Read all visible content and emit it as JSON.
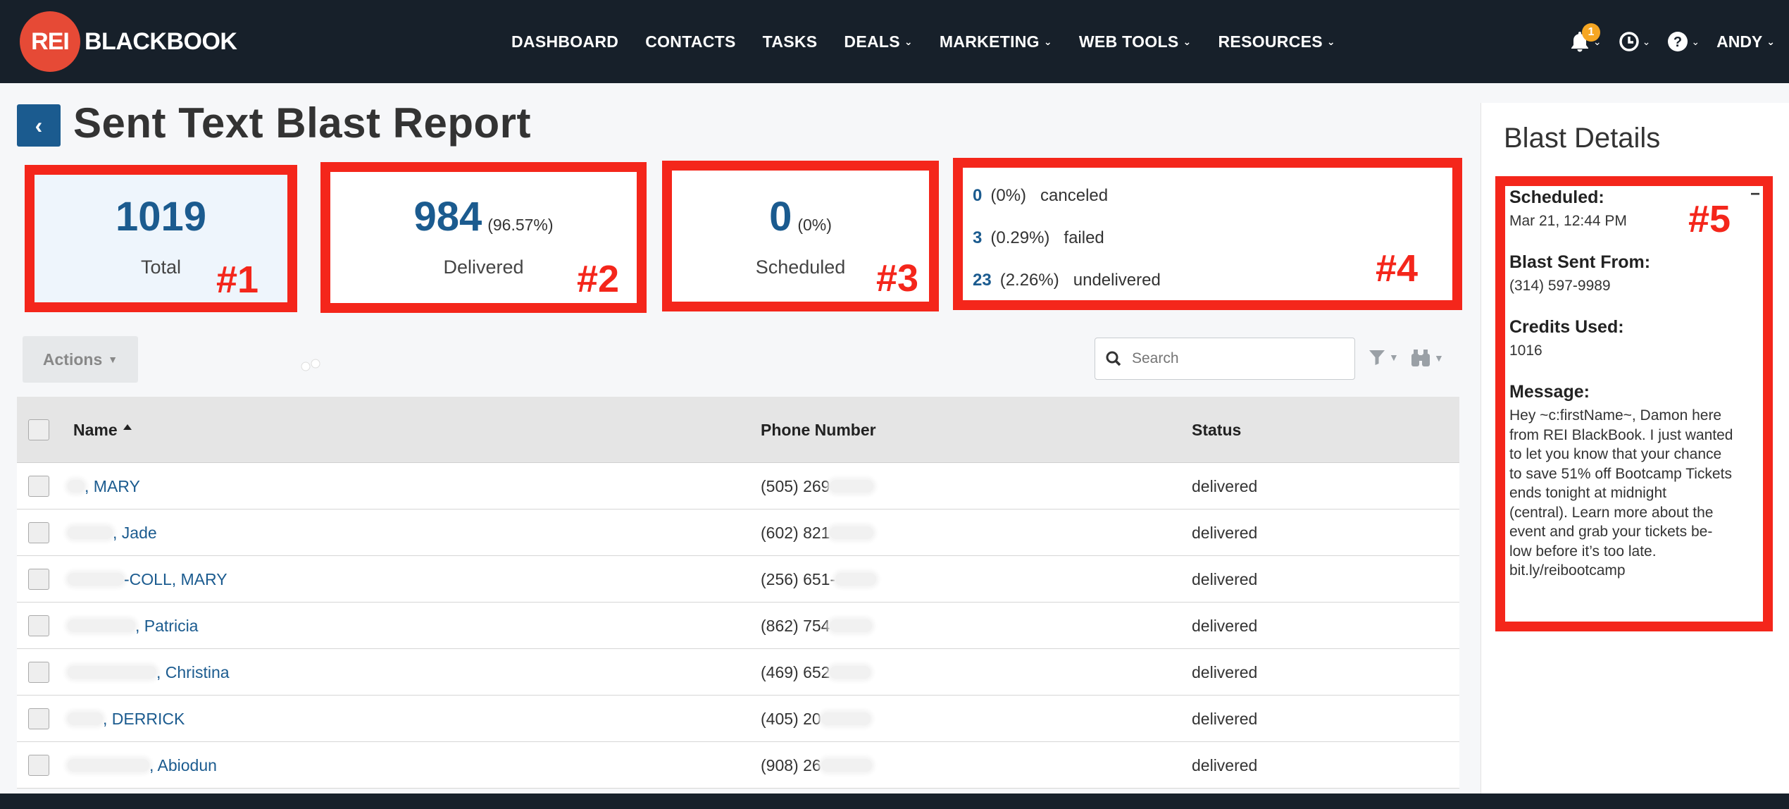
{
  "nav": {
    "logo_mark": "REI",
    "logo_text": "BLACKBOOK",
    "items": [
      {
        "label": "DASHBOARD",
        "dropdown": false
      },
      {
        "label": "CONTACTS",
        "dropdown": false
      },
      {
        "label": "TASKS",
        "dropdown": false
      },
      {
        "label": "DEALS",
        "dropdown": true
      },
      {
        "label": "MARKETING",
        "dropdown": true
      },
      {
        "label": "WEB TOOLS",
        "dropdown": true
      },
      {
        "label": "RESOURCES",
        "dropdown": true
      }
    ],
    "notification_count": "1",
    "user": "ANDY",
    "caret": "⌄"
  },
  "page": {
    "back_icon": "‹",
    "title": "Sent Text Blast Report"
  },
  "stats": {
    "total": {
      "value": "1019",
      "label": "Total",
      "marker": "#1"
    },
    "delivered": {
      "value": "984",
      "pct": "(96.57%)",
      "label": "Delivered",
      "marker": "#2"
    },
    "scheduled": {
      "value": "0",
      "pct": "(0%)",
      "label": "Scheduled",
      "marker": "#3"
    },
    "other": {
      "marker": "#4",
      "lines": [
        {
          "value": "0",
          "pct": "(0%)",
          "label": "canceled"
        },
        {
          "value": "3",
          "pct": "(0.29%)",
          "label": "failed"
        },
        {
          "value": "23",
          "pct": "(2.26%)",
          "label": "undelivered"
        }
      ]
    }
  },
  "toolbar": {
    "actions_label": "Actions",
    "search_placeholder": "Search"
  },
  "table": {
    "columns": {
      "name": "Name",
      "phone": "Phone Number",
      "status": "Status"
    },
    "rows": [
      {
        "name": ", MARY",
        "phone": "(505) 269",
        "status": "delivered"
      },
      {
        "name": ", Jade",
        "phone": "(602) 821",
        "status": "delivered"
      },
      {
        "name": "-COLL, MARY",
        "phone": "(256) 651-",
        "status": "delivered"
      },
      {
        "name": ", Patricia",
        "phone": "(862) 754",
        "status": "delivered"
      },
      {
        "name": ", Christina",
        "phone": "(469) 652",
        "status": "delivered"
      },
      {
        "name": ", DERRICK",
        "phone": "(405) 20",
        "status": "delivered"
      },
      {
        "name": ", Abiodun",
        "phone": "(908) 26",
        "status": "delivered"
      }
    ]
  },
  "details": {
    "title": "Blast Details",
    "marker": "#5",
    "scheduled_label": "Scheduled:",
    "scheduled_value": "Mar 21, 12:44 PM",
    "from_label": "Blast Sent From:",
    "from_value": "(314) 597-9989",
    "credits_label": "Credits Used:",
    "credits_value": "1016",
    "message_label": "Message:",
    "message_lines": [
      "Hey ~c:firstName~, Damon here",
      "from REI BlackBook. I just wanted",
      "to let you know that your chance",
      "to save 51% off Bootcamp Tickets",
      "ends tonight at midnight",
      "(central). Learn more about the",
      "event and grab your tickets be-",
      "low before it’s too late.",
      "bit.ly/reibootcamp"
    ]
  },
  "colors": {
    "nav_bg": "#17202a",
    "brand_blue": "#1b5b8f",
    "annotation_red": "#f4261b",
    "logo_red": "#e64a36",
    "badge_orange": "#f5a623"
  },
  "icons": [
    "bell-icon",
    "clock-icon",
    "help-icon",
    "back-chevron-icon",
    "search-icon",
    "filter-icon",
    "binoculars-icon",
    "minus-icon",
    "sort-asc-icon"
  ]
}
